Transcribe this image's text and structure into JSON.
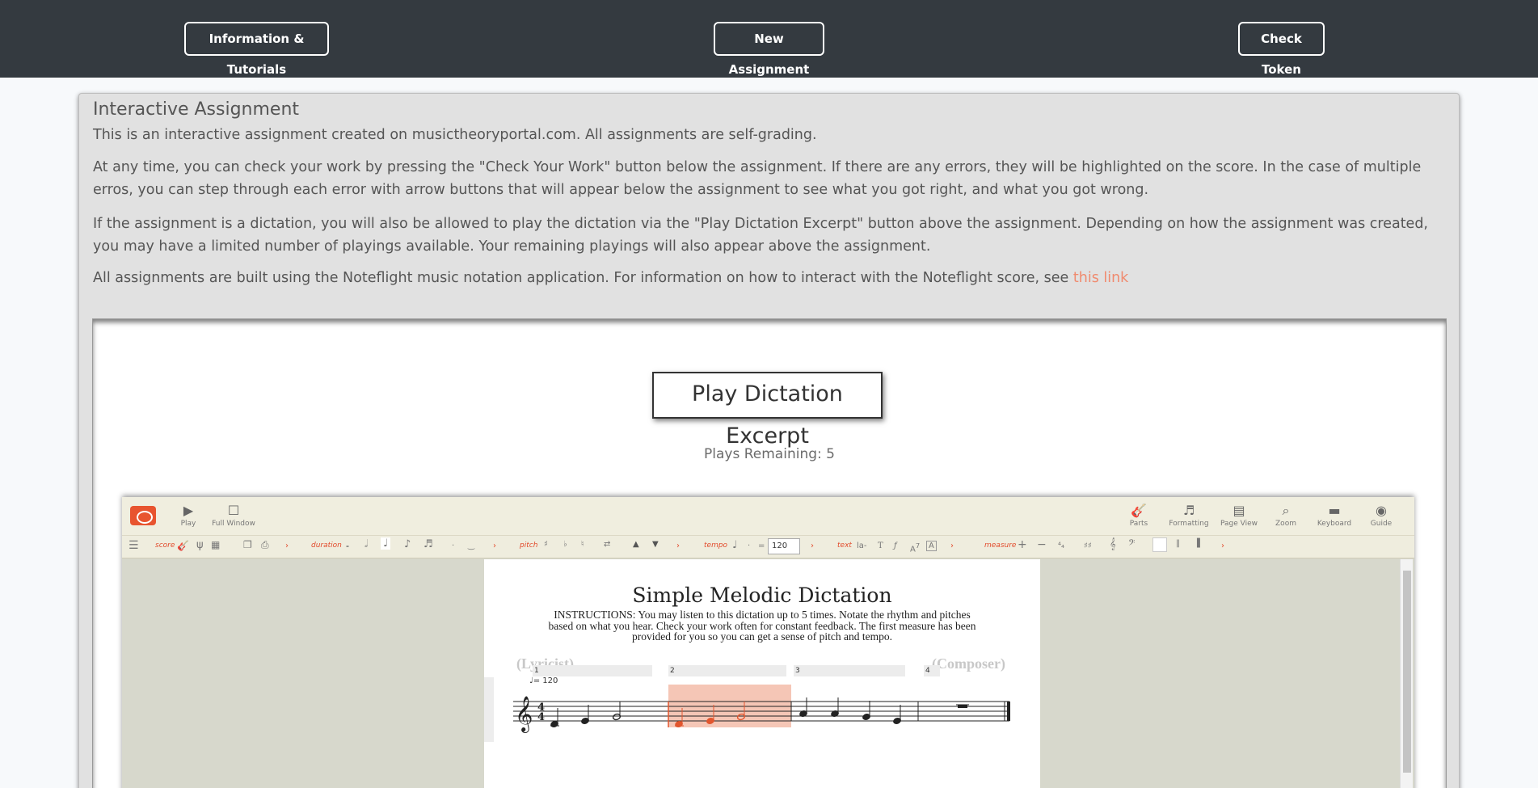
{
  "nav": {
    "info_label": "Information & Tutorials",
    "new_label": "New Assignment",
    "token_label": "Check Token"
  },
  "assignment": {
    "title": "Interactive Assignment",
    "p1": "This is an interactive assignment created on musictheoryportal.com. All assignments are self-grading.",
    "p2": "At any time, you can check your work by pressing the \"Check Your Work\" button below the assignment. If there are any errors, they will be highlighted on the score. In the case of multiple erros, you can step through each error with arrow buttons that will appear below the assignment to see what you got right, and what you got wrong.",
    "p3": "If the assignment is a dictation, you will also be allowed to play the dictation via the \"Play Dictation Excerpt\" button above the assignment. Depending on how the assignment was created, you may have a limited number of playings available. Your remaining playings will also appear above the assignment.",
    "p4_text": "All assignments are built using the Noteflight music notation application. For information on how to interact with the Noteflight score, see ",
    "p4_link": "this link",
    "play_button": "Play Dictation Excerpt",
    "plays_remaining": "Plays Remaining: 5"
  },
  "noteflight": {
    "tools_left": [
      {
        "icon": "play-icon",
        "glyph": "▶",
        "label": "Play"
      },
      {
        "icon": "full-window-icon",
        "glyph": "☐",
        "label": "Full Window"
      }
    ],
    "tools_right": [
      {
        "icon": "guitar-icon",
        "glyph": "🎸",
        "label": "Parts"
      },
      {
        "icon": "formatting-icon",
        "glyph": "♬",
        "label": "Formatting"
      },
      {
        "icon": "page-view-icon",
        "glyph": "▤",
        "label": "Page View"
      },
      {
        "icon": "zoom-icon",
        "glyph": "⌕",
        "label": "Zoom"
      },
      {
        "icon": "keyboard-icon",
        "glyph": "▬",
        "label": "Keyboard"
      },
      {
        "icon": "guide-icon",
        "glyph": "◉",
        "label": "Guide"
      }
    ],
    "palette": {
      "score": "score",
      "duration": "duration",
      "pitch": "pitch",
      "tempo": "tempo",
      "tempo_eq": "=",
      "tempo_value": "120",
      "text": "text",
      "measure": "measure"
    },
    "score": {
      "title": "Simple Melodic Dictation",
      "instructions": "INSTRUCTIONS: You may listen to this dictation up to 5 times. Notate the rhythm and pitches based on what you hear. Check your work often for constant feedback. The first measure has been provided for you so you can get a sense of pitch and tempo.",
      "lyricist": "(Lyricist)",
      "composer": "(Composer)",
      "tempo_mark": "= 120",
      "time_sig_top": "4",
      "time_sig_bottom": "4",
      "measures": [
        "1",
        "2",
        "3",
        "4"
      ]
    }
  },
  "colors": {
    "nav_bg": "#343a40",
    "panel_bg": "#e1e1e1",
    "link": "#f08a6e",
    "error_highlight": "#f5c6b6",
    "error_note": "#e2562e"
  }
}
